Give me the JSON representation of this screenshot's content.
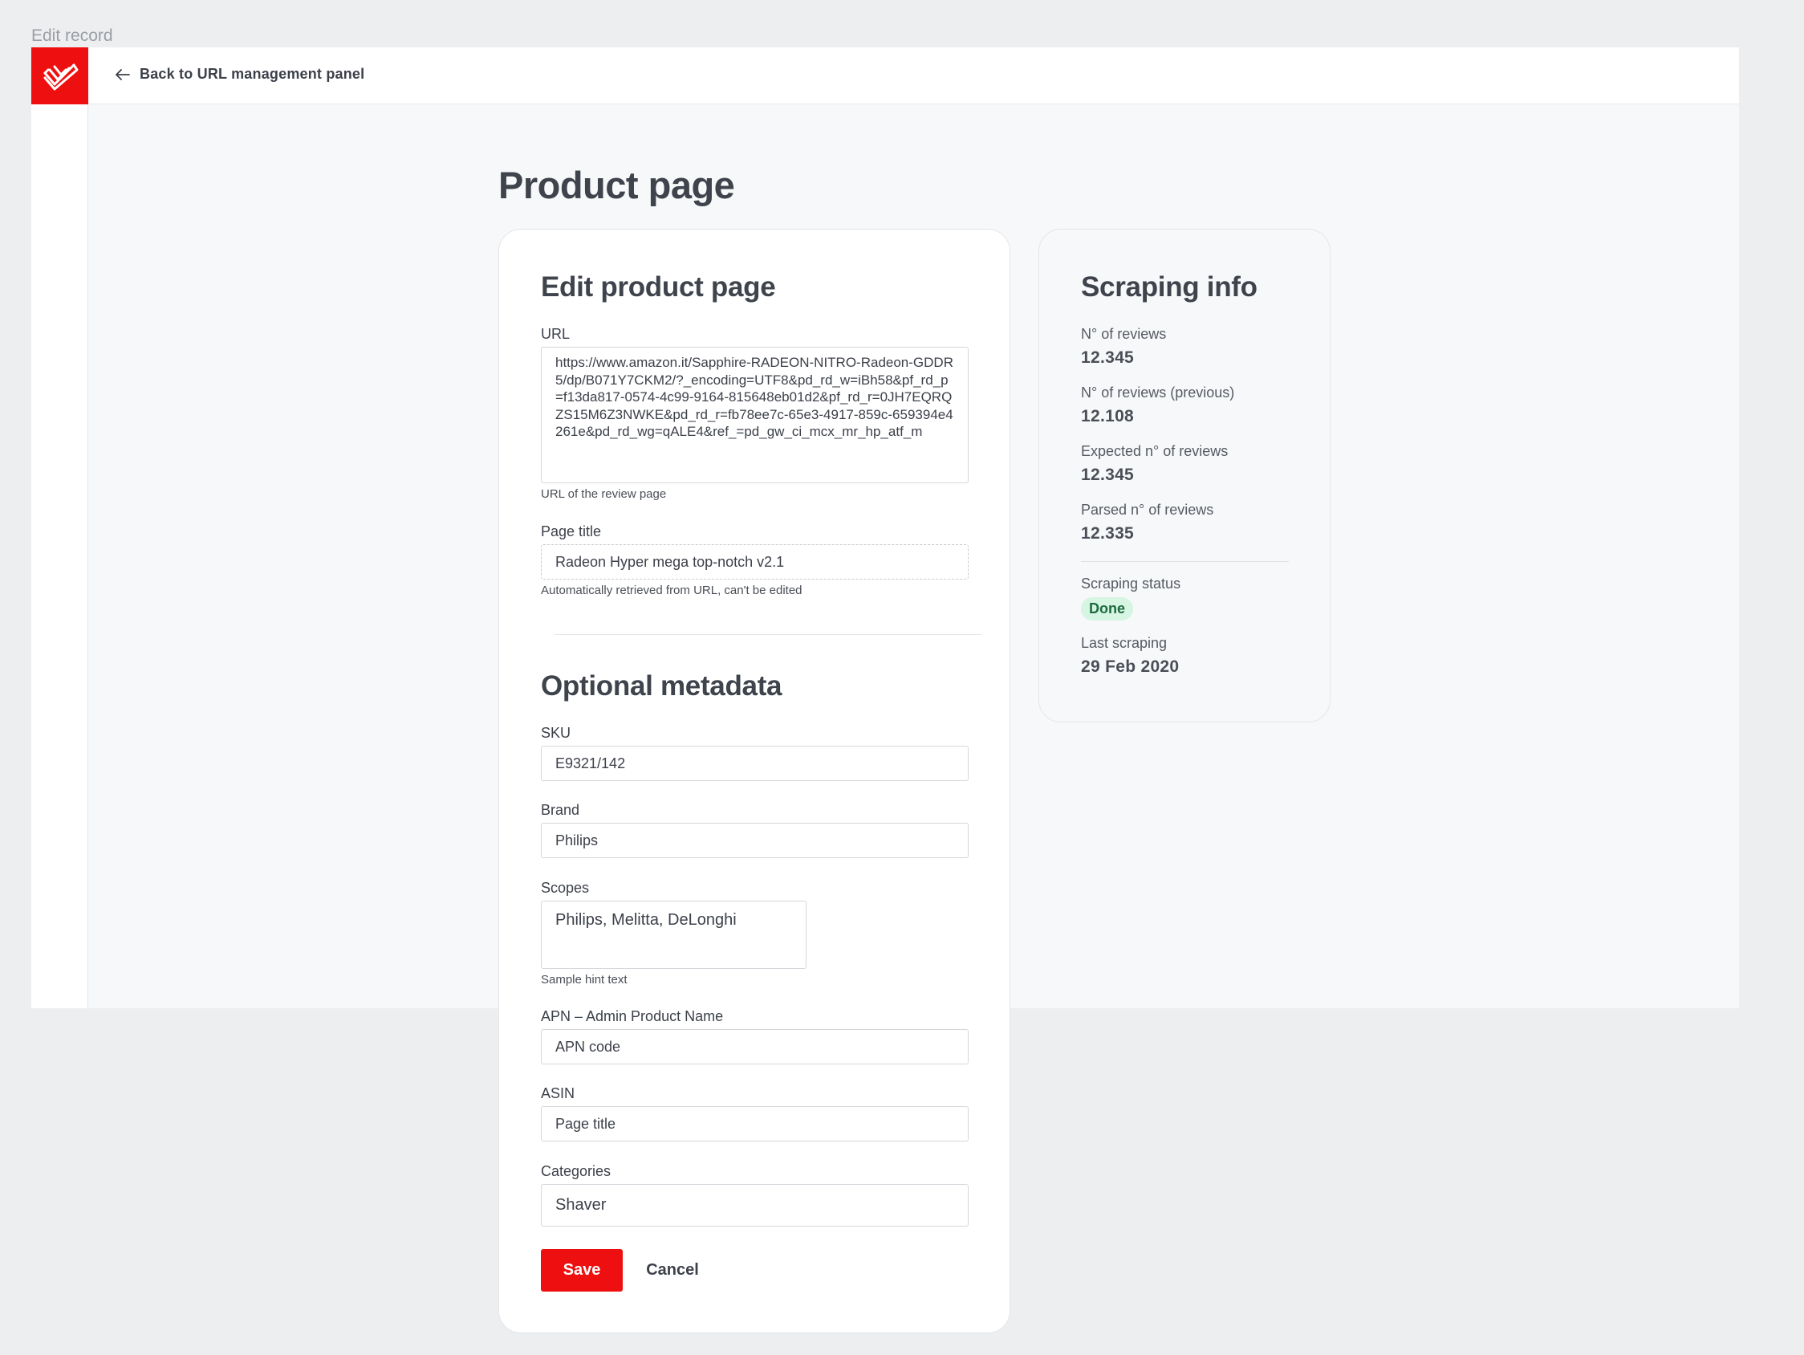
{
  "window": {
    "caption": "Edit record"
  },
  "topbar": {
    "back_label": "Back to URL management panel"
  },
  "page": {
    "title": "Product page"
  },
  "edit_card": {
    "heading": "Edit product page",
    "url": {
      "label": "URL",
      "value": "https://www.amazon.it/Sapphire-RADEON-NITRO-Radeon-GDDR5/dp/B071Y7CKM2/?_encoding=UTF8&pd_rd_w=iBh58&pf_rd_p=f13da817-0574-4c99-9164-815648eb01d2&pf_rd_r=0JH7EQRQZS15M6Z3NWKE&pd_rd_r=fb78ee7c-65e3-4917-859c-659394e4261e&pd_rd_wg=qALE4&ref_=pd_gw_ci_mcx_mr_hp_atf_m",
      "hint": "URL of the review page"
    },
    "page_title": {
      "label": "Page title",
      "value": "Radeon Hyper mega top-notch v2.1",
      "hint": "Automatically retrieved from URL, can't be edited"
    }
  },
  "metadata": {
    "heading": "Optional metadata",
    "sku": {
      "label": "SKU",
      "value": "E9321/142"
    },
    "brand": {
      "label": "Brand",
      "value": "Philips"
    },
    "scopes": {
      "label": "Scopes",
      "value": "Philips, Melitta, DeLonghi",
      "hint": "Sample hint text"
    },
    "apn": {
      "label": "APN – Admin Product Name",
      "placeholder": "APN code"
    },
    "asin": {
      "label": "ASIN",
      "placeholder": "Page title"
    },
    "categories": {
      "label": "Categories",
      "value": "Shaver"
    }
  },
  "actions": {
    "save_label": "Save",
    "cancel_label": "Cancel"
  },
  "scraping": {
    "heading": "Scraping info",
    "reviews": {
      "label": "N° of reviews",
      "value": "12.345"
    },
    "reviews_prev": {
      "label": "N° of reviews (previous)",
      "value": "12.108"
    },
    "expected": {
      "label": "Expected n° of reviews",
      "value": "12.345"
    },
    "parsed": {
      "label": "Parsed n° of reviews",
      "value": "12.335"
    },
    "status": {
      "label": "Scraping status",
      "value": "Done",
      "color": "#d6f5e3"
    },
    "last": {
      "label": "Last scraping",
      "value": "29 Feb 2020"
    }
  },
  "colors": {
    "brand": "#ee1010",
    "background": "#edeef0"
  }
}
